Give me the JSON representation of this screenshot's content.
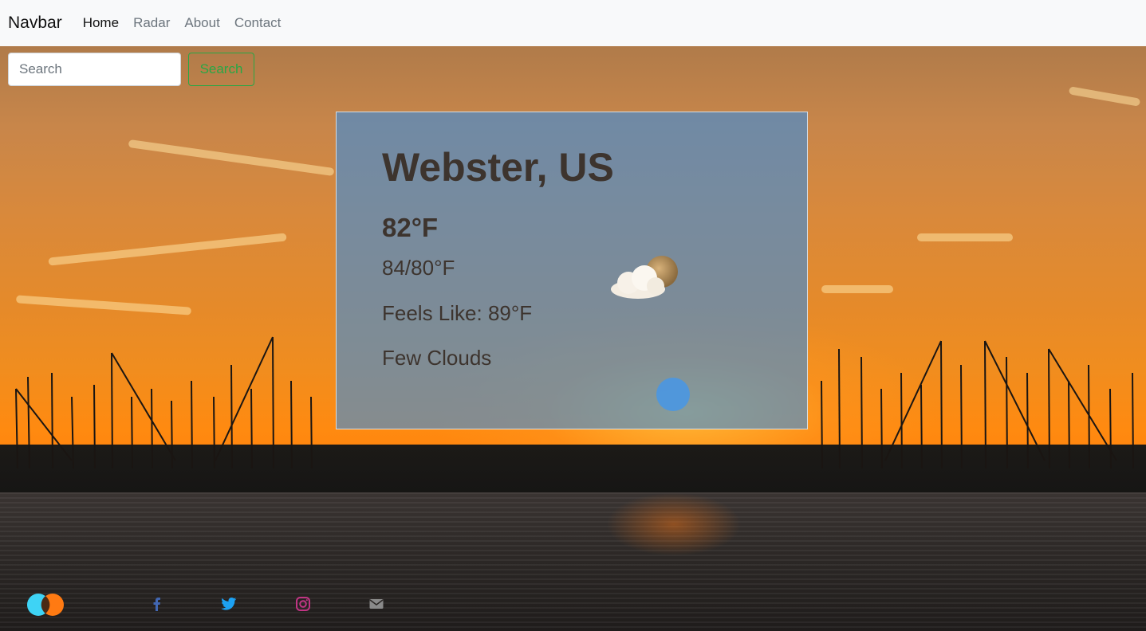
{
  "navbar": {
    "brand": "Navbar",
    "links": [
      {
        "label": "Home",
        "active": true
      },
      {
        "label": "Radar",
        "active": false
      },
      {
        "label": "About",
        "active": false
      },
      {
        "label": "Contact",
        "active": false
      }
    ]
  },
  "search": {
    "placeholder": "Search",
    "button_label": "Search"
  },
  "weather": {
    "city": "Webster, US",
    "temperature": "82°F",
    "high_low": "84/80°F",
    "feels_like": "Feels Like: 89°F",
    "description": "Few Clouds",
    "icon": "few-clouds-icon"
  },
  "footer": {
    "logo_icon": "overlapping-circles-logo",
    "social_icons": [
      "facebook-icon",
      "twitter-icon",
      "instagram-icon",
      "envelope-icon"
    ]
  },
  "colors": {
    "navbar_bg": "#f8f9fa",
    "search_button": "#28a745",
    "card_bg": "#3c8cdc",
    "card_text": "#3d342e",
    "facebook": "#4267b2",
    "twitter": "#1da1f2",
    "instagram": "#c13584",
    "email": "#888888"
  }
}
